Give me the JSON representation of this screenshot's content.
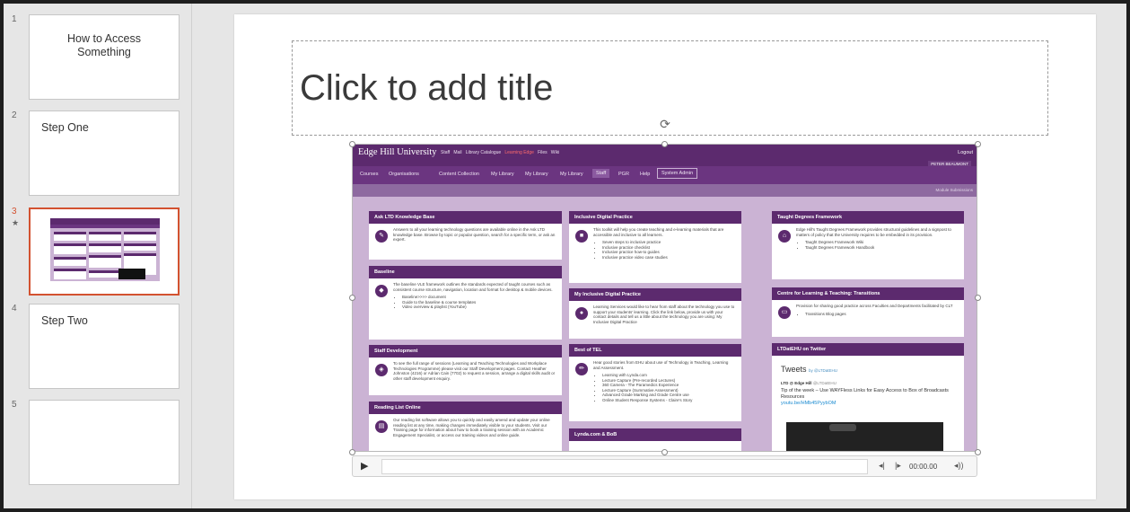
{
  "thumbnails": [
    {
      "number": "1",
      "title": "How to Access Something"
    },
    {
      "number": "2",
      "title": "Step One"
    },
    {
      "number": "3",
      "title": "",
      "marker": "★"
    },
    {
      "number": "4",
      "title": "Step Two"
    },
    {
      "number": "5",
      "title": ""
    }
  ],
  "slide": {
    "title_placeholder": "Click to add title"
  },
  "website": {
    "logo": "Edge Hill University",
    "top_links": [
      "Staff",
      "Mail",
      "Library Catalogue",
      "Learning Edge",
      "Files",
      "Wiki"
    ],
    "logout": "Logout",
    "user": "PETER BEAUMONT",
    "nav": [
      "Courses",
      "Organisations",
      "Content Collection",
      "My Library",
      "My Library",
      "My Library",
      "Staff",
      "PGR",
      "Help",
      "System Admin"
    ],
    "sub": "Module Submissions",
    "cards": {
      "ask_ltd": {
        "title": "Ask LTD Knowledge Base",
        "text": "Answers to all your learning technology questions are available online in the Ask LTD knowledge base. Browse by topic or popular question, search for a specific term, or ask an expert."
      },
      "baseline": {
        "title": "Baseline",
        "text": "The baseline VLE framework outlines the standards expected of taught courses such as consistent course structure, navigation, location and format for desktop & mobile devices.",
        "items": [
          "Baseline>>>> document",
          "Guide to the baseline & course templates",
          "Video overview & playlist (YouTube)"
        ]
      },
      "staff_dev": {
        "title": "Staff Development",
        "text": "To see the full range of sessions (Learning and Teaching Technologies and Workplace Technologies Programme) please visit our Staff Development pages. Contact Heather Johnston (4216) or Adrian Cain (7702) to request a session, arrange a digital skills audit or other staff development enquiry."
      },
      "reading_list": {
        "title": "Reading List Online",
        "text": "Our reading list software allows you to quickly and easily amend and update your online reading list at any time, making changes immediately visible to your students. Visit our Training page for information about how to book a training session with an Academic Engagement Specialist, or access our training videos and online guide."
      },
      "inclusive": {
        "title": "Inclusive Digital Practice",
        "text": "This toolkit will help you create teaching and e-learning materials that are accessible and inclusive to all learners.",
        "items": [
          "Seven steps to inclusive practice",
          "Inclusive practice checklist",
          "Inclusive practice how-to guides",
          "Inclusive practice video case studies"
        ]
      },
      "my_inclusive": {
        "title": "My Inclusive Digital Practice",
        "text": "Learning Services would like to hear from staff about the technology you use to support your students' learning. Click the link below, provide us with your contact details and tell us a little about the technology you are using: My Inclusive Digital Practice"
      },
      "best_tel": {
        "title": "Best of TEL",
        "text": "Hear good stories from EHU about use of Technology in Teaching, Learning and Assessment.",
        "items": [
          "Learning with Lynda.com",
          "Lecture Capture (Pre-recorded Lectures)",
          "360 Camera - The Paramedics Experience",
          "Lecture Capture (Summative Assessment)",
          "Advanced Grade Marking and Grade Centre use",
          "Online Student Response Systems - Claire's Story"
        ]
      },
      "lynda": {
        "title": "Lynda.com & BoB"
      },
      "taught": {
        "title": "Taught Degrees Framework",
        "text": "Edge Hill's Taught Degrees Framework provides structural guidelines and a signpost to matters of policy that the University requires to be embedded in its provision.",
        "items": [
          "Taught Degrees Framework Wiki",
          "Taught Degrees Framework Handbook"
        ]
      },
      "centre": {
        "title": "Centre for Learning & Teaching: Transitions",
        "text": "Provision for sharing good practice across Faculties and Departments facilitated by CLT",
        "items": [
          "Transitions Blog pages"
        ]
      },
      "twitter": {
        "title": "LTDatEHU on Twitter",
        "tweets_label": "Tweets",
        "tweets_by": "by @LTDatEHU",
        "account": "LTD @ Edge Hill",
        "handle": "@LTDatEHU",
        "tweet": "Tip of the week – Use WAYFless Links for Easy Access to Box of Broadcasts Resources",
        "link": "youtu.be/HMb45PyybOM"
      }
    }
  },
  "media": {
    "time": "00:00.00"
  },
  "colors": {
    "accent": "#d35230",
    "site_purple": "#5c2a6e",
    "site_bg": "#cbb3d4"
  }
}
